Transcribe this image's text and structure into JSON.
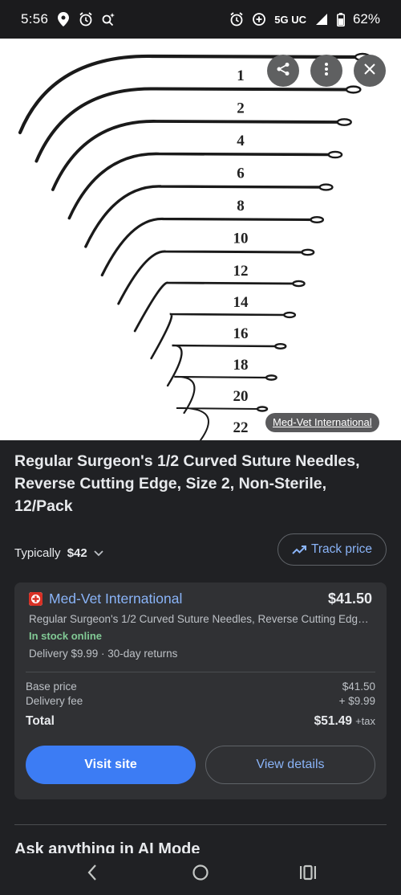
{
  "status_bar": {
    "time": "5:56",
    "network": "5G UC",
    "battery": "62%",
    "left_icons": [
      "location-icon",
      "alarm-icon",
      "search-sparkle-icon"
    ],
    "right_icons": [
      "alarm-icon",
      "data-saver-icon",
      "signal-icon",
      "battery-icon"
    ]
  },
  "image": {
    "needle_labels": [
      "1",
      "2",
      "4",
      "6",
      "8",
      "10",
      "12",
      "14",
      "16",
      "18",
      "20",
      "22"
    ],
    "source_chip": "Med-Vet International",
    "actions": [
      "share-icon",
      "more-vert-icon",
      "close-icon"
    ]
  },
  "product": {
    "title": "Regular Surgeon's 1/2 Curved Suture Needles, Reverse Cutting Edge, Size 2, Non-Sterile, 12/Pack",
    "typical_prefix": "Typically ",
    "typical_price": "$42",
    "track_price_label": "Track price"
  },
  "offer": {
    "merchant": "Med-Vet International",
    "price": "$41.50",
    "description": "Regular Surgeon's 1/2 Curved Suture Needles, Reverse Cutting Edge, Size 2, Non-Sterile, 12/Pack",
    "stock": "In stock online",
    "delivery": "Delivery $9.99 · 30-day returns",
    "base_price_label": "Base price",
    "base_price": "$41.50",
    "delivery_fee_label": "Delivery fee",
    "delivery_fee": "+ $9.99",
    "total_label": "Total",
    "total": "$51.49",
    "tax": "+tax",
    "visit_label": "Visit site",
    "details_label": "View details",
    "colors": {
      "accent": "#3c7cf4",
      "link": "#8ab4f8",
      "stock": "#81c995"
    }
  },
  "ask_ai": "Ask anything in AI Mode",
  "nav": [
    "back-icon",
    "home-icon",
    "recents-icon"
  ]
}
